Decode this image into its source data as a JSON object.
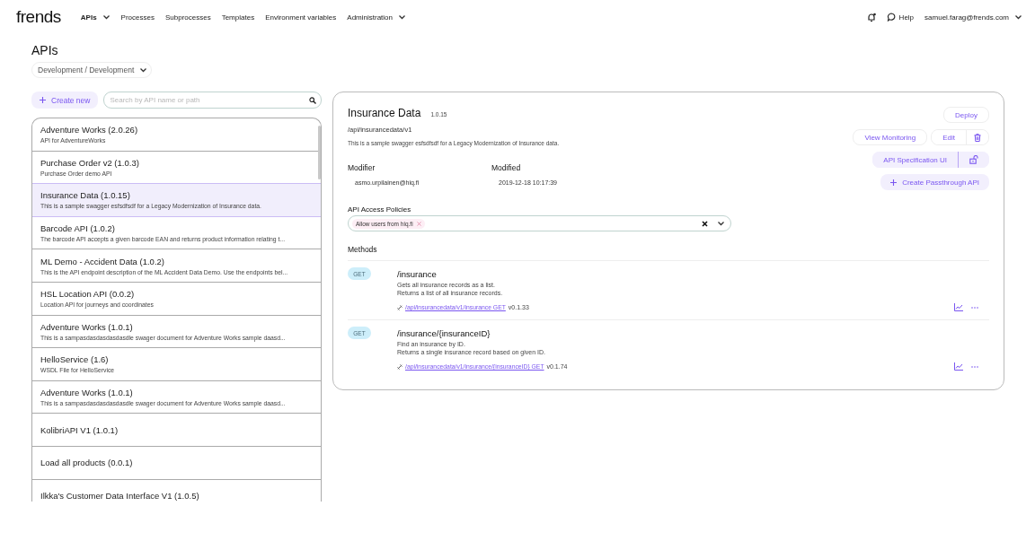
{
  "nav": {
    "logo": "frends",
    "items": [
      {
        "label": "APIs",
        "selected": true,
        "dropdown": true
      },
      {
        "label": "Processes",
        "selected": false,
        "dropdown": false
      },
      {
        "label": "Subprocesses",
        "selected": false,
        "dropdown": false
      },
      {
        "label": "Templates",
        "selected": false,
        "dropdown": false
      },
      {
        "label": "Environment variables",
        "selected": false,
        "dropdown": false
      },
      {
        "label": "Administration",
        "selected": false,
        "dropdown": true
      }
    ],
    "help": "Help",
    "user": "samuel.farag@frends.com"
  },
  "page_title": "APIs",
  "environment": "Development / Development",
  "create_button": "Create new",
  "search": {
    "placeholder": "Search by API name or path"
  },
  "api_list": [
    {
      "title": "Adventure Works (2.0.26)",
      "description": "API for AdventureWorks",
      "selected": false
    },
    {
      "title": "Purchase Order v2 (1.0.3)",
      "description": "Purchase Order demo API",
      "selected": false
    },
    {
      "title": "Insurance Data (1.0.15)",
      "description": "This is a sample swagger esfsdfsdf for a Legacy Modernization of Insurance data.",
      "selected": true
    },
    {
      "title": "Barcode API (1.0.2)",
      "description": "The barcode API accepts a given barcode EAN and returns product information relating t...",
      "selected": false
    },
    {
      "title": "ML Demo - Accident Data (1.0.2)",
      "description": "This is the API endpoint description of the ML Accident Data Demo. Use the endpoints bel...",
      "selected": false
    },
    {
      "title": "HSL Location API (0.0.2)",
      "description": "Location API for journeys and coordinates",
      "selected": false
    },
    {
      "title": "Adventure Works (1.0.1)",
      "description": "This is a sampasdasdasdasdasdle swager document for Adventure Works sample daasd...",
      "selected": false
    },
    {
      "title": "HelloService (1.6)",
      "description": "WSDL File for HelloService",
      "selected": false
    },
    {
      "title": "Adventure Works (1.0.1)",
      "description": "This is a sampasdasdasdasdasdle swager document for Adventure Works sample daasd...",
      "selected": false
    },
    {
      "title": "KolibriAPI V1 (1.0.1)",
      "selected": false
    },
    {
      "title": "Load all products (0.0.1)",
      "selected": false
    },
    {
      "title": "Ilkka's Customer Data Interface V1 (1.0.5)",
      "selected": false
    }
  ],
  "detail": {
    "name": "Insurance Data",
    "version": "1.0.15",
    "path": "/api/insurancedata/v1",
    "description": "This is a sample swagger esfsdfsdf for a Legacy Modernization of Insurance data.",
    "deploy_button": "Deploy",
    "monitoring_button": "View Monitoring",
    "edit_button": "Edit",
    "spec_button": "API Specification UI",
    "passthrough_button": "Create Passthrough API",
    "modifier_label": "Modifier",
    "modifier": "asmo.urpilainen@hiq.fi",
    "modified_label": "Modified",
    "modified": "2019-12-18 10:17:39",
    "policies_label": "API Access Policies",
    "policies": [
      {
        "label": "Allow users from hiq.fi"
      }
    ],
    "methods_label": "Methods",
    "methods": [
      {
        "verb": "GET",
        "path": "/insurance",
        "summary": "Gets all insurance records as a list.",
        "description": "Returns a list of all insurance records.",
        "link": "/api/insurancedata/v1/insurance GET",
        "version": "v0.1.33"
      },
      {
        "verb": "GET",
        "path": "/insurance/{insuranceID}",
        "summary": "Find an insurance by ID.",
        "description": "Returns a single insurance record based on given ID.",
        "link": "/api/insurancedata/v1/insurance/{insuranceID} GET",
        "version": "v0.1.74"
      }
    ]
  }
}
